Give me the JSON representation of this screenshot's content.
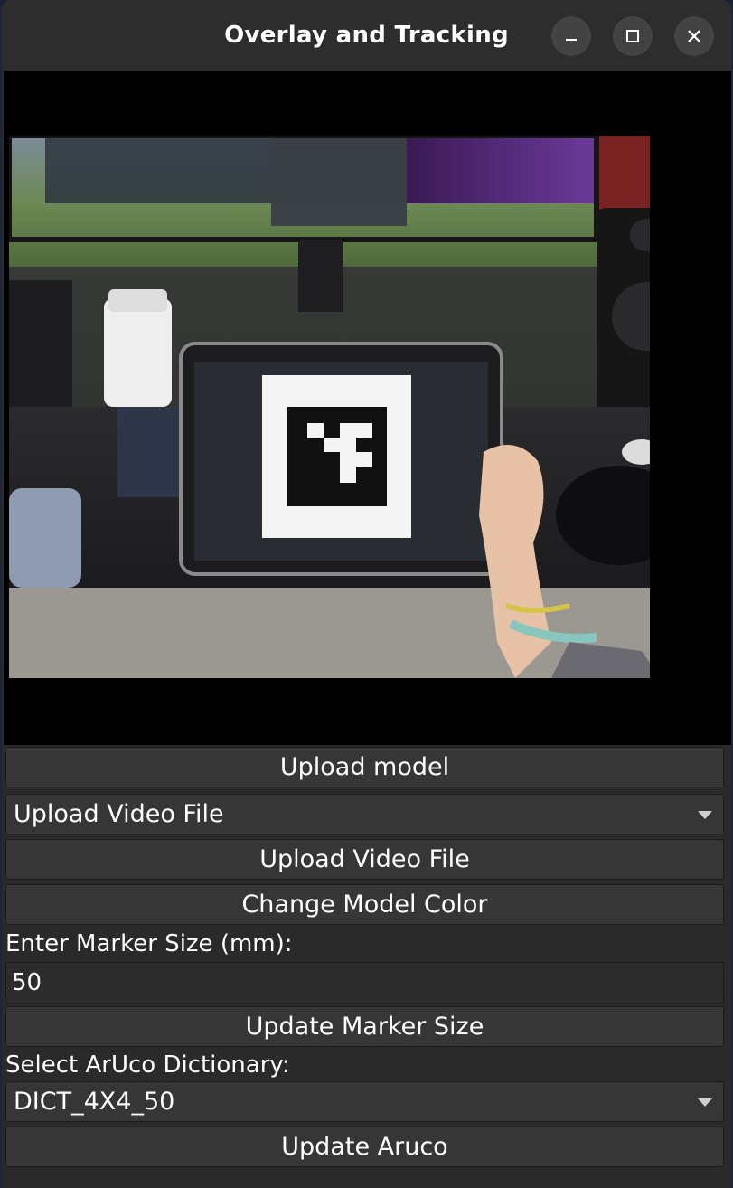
{
  "window": {
    "title": "Overlay and Tracking",
    "minimize_icon": "minimize-icon",
    "maximize_icon": "maximize-icon",
    "close_icon": "close-icon"
  },
  "video": {
    "aruco_marker": "aruco-marker"
  },
  "controls": {
    "upload_model_label": "Upload model",
    "source_select_value": "Upload Video File",
    "upload_video_label": "Upload Video File",
    "change_color_label": "Change Model Color",
    "marker_size_label": "Enter Marker Size (mm):",
    "marker_size_value": "50",
    "update_marker_size_label": "Update Marker Size",
    "aruco_dict_label": "Select ArUco Dictionary:",
    "aruco_dict_value": "DICT_4X4_50",
    "update_aruco_label": "Update Aruco"
  },
  "colors": {
    "background": "#2a2a2a",
    "button": "#363636",
    "text": "#ffffff"
  }
}
